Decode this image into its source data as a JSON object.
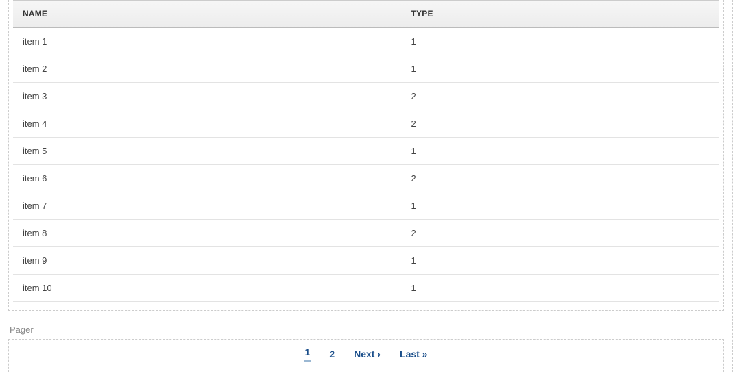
{
  "table": {
    "headers": {
      "name": "NAME",
      "type": "TYPE"
    },
    "rows": [
      {
        "name": "item 1",
        "type": "1"
      },
      {
        "name": "item 2",
        "type": "1"
      },
      {
        "name": "item 3",
        "type": "2"
      },
      {
        "name": "item 4",
        "type": "2"
      },
      {
        "name": "item 5",
        "type": "1"
      },
      {
        "name": "item 6",
        "type": "2"
      },
      {
        "name": "item 7",
        "type": "1"
      },
      {
        "name": "item 8",
        "type": "2"
      },
      {
        "name": "item 9",
        "type": "1"
      },
      {
        "name": "item 10",
        "type": "1"
      }
    ]
  },
  "pager": {
    "label": "Pager",
    "page1": "1",
    "page2": "2",
    "next": "Next ›",
    "last": "Last »"
  }
}
